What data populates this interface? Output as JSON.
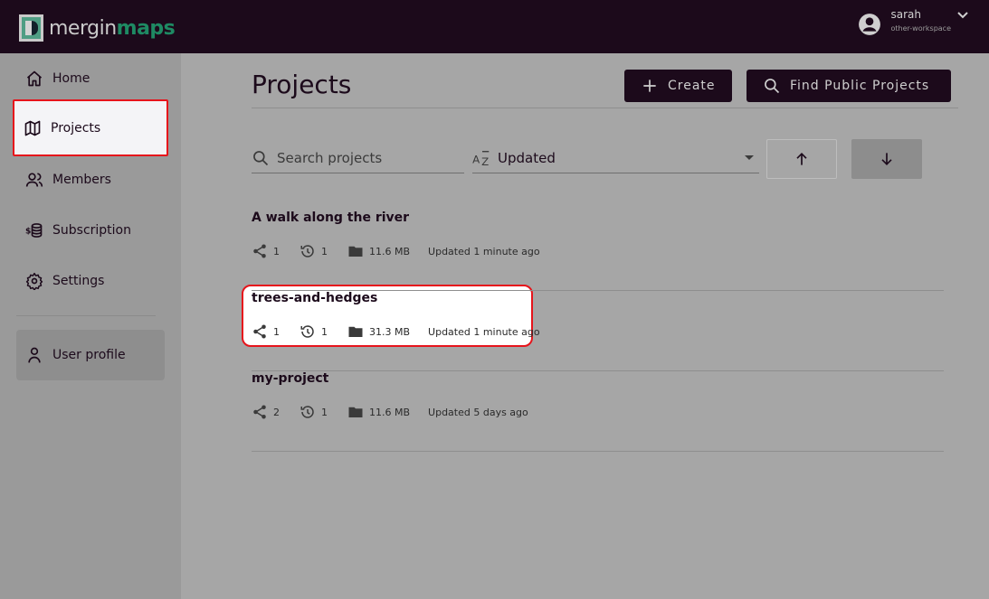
{
  "brand": {
    "name_part1": "mergin",
    "name_part2": "maps"
  },
  "user": {
    "name": "sarah",
    "workspace": "other-workspace"
  },
  "sidebar": {
    "items": [
      {
        "label": "Home",
        "icon": "home-icon"
      },
      {
        "label": "Projects",
        "icon": "map-icon"
      },
      {
        "label": "Members",
        "icon": "users-icon"
      },
      {
        "label": "Subscription",
        "icon": "coins-icon"
      },
      {
        "label": "Settings",
        "icon": "gear-icon"
      }
    ],
    "profile": {
      "label": "User profile",
      "icon": "user-icon"
    }
  },
  "main": {
    "title": "Projects",
    "create_label": "Create",
    "find_label": "Find Public Projects",
    "search_placeholder": "Search projects",
    "sort_value": "Updated"
  },
  "projects": [
    {
      "name": "A walk along the river",
      "shares": "1",
      "versions": "1",
      "size": "11.6 MB",
      "updated": "Updated 1 minute ago"
    },
    {
      "name": "trees-and-hedges",
      "shares": "1",
      "versions": "1",
      "size": "31.3 MB",
      "updated": "Updated 1 minute ago"
    },
    {
      "name": "my-project",
      "shares": "2",
      "versions": "1",
      "size": "11.6 MB",
      "updated": "Updated 5 days ago"
    }
  ],
  "colors": {
    "primary": "#1c0a1b",
    "accent": "#1e8a63",
    "highlight": "#e6141b"
  }
}
